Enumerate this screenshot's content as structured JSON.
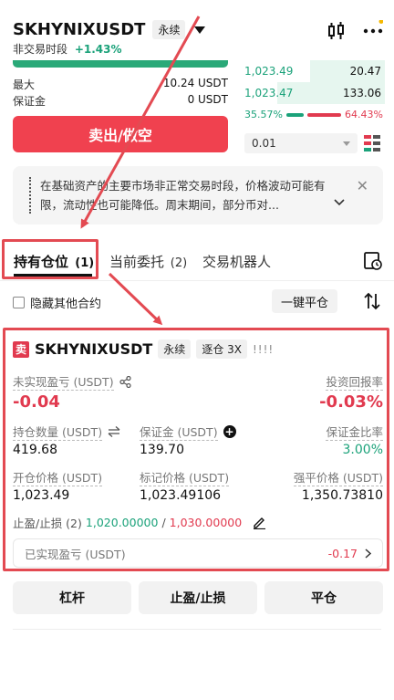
{
  "header": {
    "symbol": "SKHYNIXUSDT",
    "contract_type": "永续",
    "session_label": "非交易时段",
    "change": "+1.43%"
  },
  "order_panel": {
    "max_label": "最大",
    "max_value": "10.24 USDT",
    "margin_label": "保证金",
    "margin_value": "0 USDT",
    "sell_button": "卖出/做空"
  },
  "orderbook": {
    "bids": [
      {
        "price": "1,023.49",
        "qty": "20.47"
      },
      {
        "price": "1,023.47",
        "qty": "133.06"
      }
    ],
    "buy_ratio": "35.57%",
    "sell_ratio": "64.43%",
    "buy_fraction": 0.3557,
    "precision_value": "0.01"
  },
  "notice": {
    "text": "在基础资产的主要市场非正常交易时段，价格波动可能有限，流动性也可能降低。周末期间，部分币对..."
  },
  "tabs": [
    {
      "label": "持有仓位",
      "count": "(1)"
    },
    {
      "label": "当前委托",
      "count": "(2)"
    },
    {
      "label": "交易机器人",
      "count": ""
    }
  ],
  "filter": {
    "hide_others_label": "隐藏其他合约",
    "close_all_button": "一键平仓"
  },
  "position": {
    "side_badge": "卖",
    "symbol": "SKHYNIXUSDT",
    "contract_type": "永续",
    "margin_mode": "逐仓 3X",
    "signal": "!!!!",
    "unrealized_pnl_label": "未实现盈亏 (USDT)",
    "unrealized_pnl_value": "-0.04",
    "roi_label": "投资回报率",
    "roi_value": "-0.03%",
    "size_label": "持仓数量 (USDT)",
    "size_value": "419.68",
    "margin_label": "保证金 (USDT)",
    "margin_value": "139.70",
    "margin_ratio_label": "保证金比率",
    "margin_ratio_value": "3.00%",
    "entry_price_label": "开仓价格 (USDT)",
    "entry_price_value": "1,023.49",
    "mark_price_label": "标记价格 (USDT)",
    "mark_price_value": "1,023.49106",
    "liq_price_label": "强平价格 (USDT)",
    "liq_price_value": "1,350.73810",
    "tpsl_label": "止盈/止损 (2)",
    "tp_value": "1,020.00000",
    "tpsl_separator": "/",
    "sl_value": "1,030.00000",
    "realized_pnl_label": "已实现盈亏 (USDT)",
    "realized_pnl_value": "-0.17"
  },
  "actions": {
    "leverage_button": "杠杆",
    "tpsl_button": "止盈/止损",
    "close_button": "平仓"
  },
  "colors": {
    "green": "#1ba27a",
    "red": "#e13a4f",
    "annotation_red": "#e34a52",
    "sell_button": "#f0414f"
  }
}
